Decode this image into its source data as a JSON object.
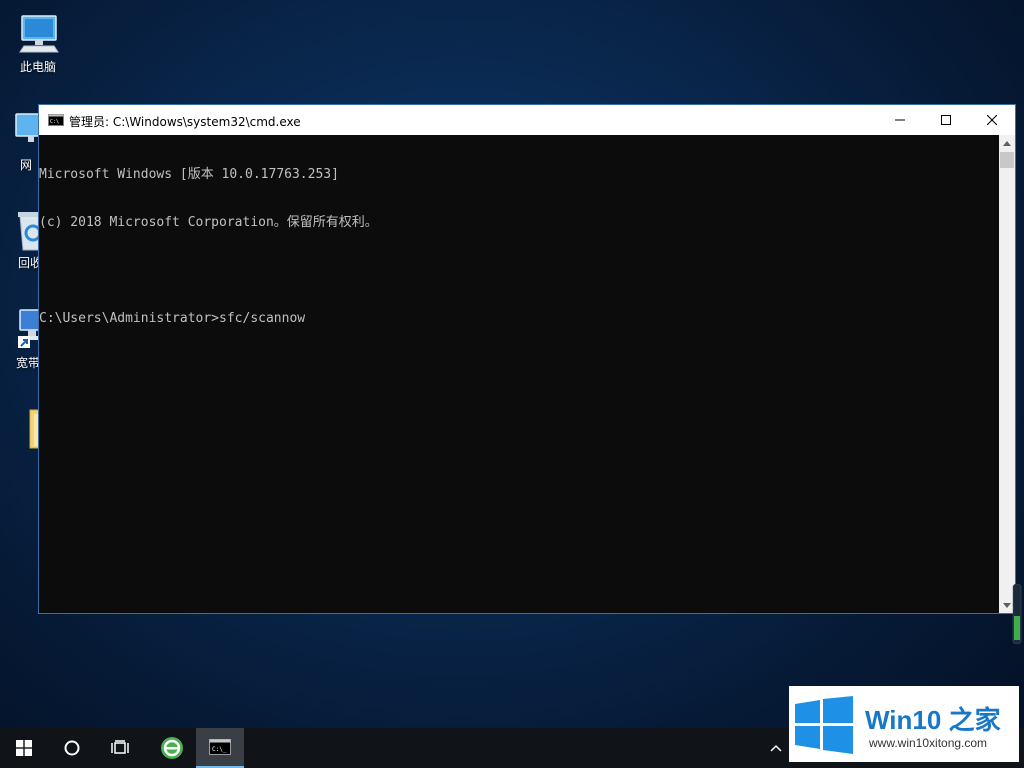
{
  "desktop": {
    "icons": [
      {
        "label": "此电脑",
        "icon": "computer-icon"
      },
      {
        "label": "网",
        "icon": "network-icon"
      },
      {
        "label": "回收",
        "icon": "recycle-bin-icon"
      },
      {
        "label": "宽带",
        "icon": "broadband-connection-icon"
      },
      {
        "label": "",
        "icon": "folder-icon"
      }
    ]
  },
  "window": {
    "title": "管理员: C:\\Windows\\system32\\cmd.exe",
    "icon": "cmd-icon",
    "controls": {
      "minimize": "minimize-icon",
      "maximize": "maximize-icon",
      "close": "close-icon"
    }
  },
  "console": {
    "lines": [
      "Microsoft Windows [版本 10.0.17763.253]",
      "(c) 2018 Microsoft Corporation。保留所有权利。",
      "",
      "C:\\Users\\Administrator>sfc/scannow"
    ],
    "text_color": "#c0c0c0",
    "background": "#0c0c0c"
  },
  "taskbar": {
    "items": [
      {
        "icon": "windows-start-icon"
      },
      {
        "icon": "cortana-circle-icon"
      },
      {
        "icon": "task-view-icon"
      },
      {
        "icon": "browser-icon"
      },
      {
        "icon": "cmd-taskbar-icon",
        "active": true
      }
    ],
    "tray_icon": "chevron-up-icon"
  },
  "watermark": {
    "brand_prefix": "Win10",
    "brand_suffix": " 之家",
    "url": "www.win10xitong.com",
    "brand_color": "#1878c8"
  }
}
